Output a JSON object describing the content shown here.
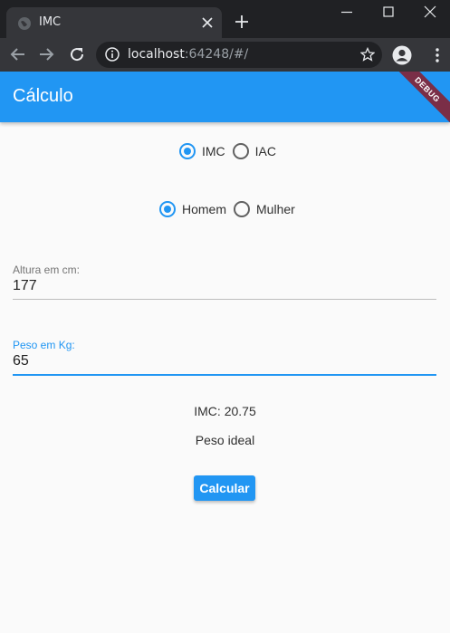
{
  "browser": {
    "tab_title": "IMC",
    "url_host": "localhost",
    "url_rest": ":64248/#/"
  },
  "app": {
    "title": "Cálculo",
    "debug_banner": "DEBUG",
    "calc_type": {
      "options": [
        "IMC",
        "IAC"
      ],
      "selected": "IMC"
    },
    "sex": {
      "options": [
        "Homem",
        "Mulher"
      ],
      "selected": "Homem"
    },
    "height_field": {
      "label": "Altura em cm:",
      "value": "177"
    },
    "weight_field": {
      "label": "Peso em Kg:",
      "value": "65"
    },
    "result_text": "IMC: 20.75",
    "classification": "Peso ideal",
    "calculate_button": "Calcular"
  },
  "colors": {
    "primary": "#2196f3",
    "chrome_dark": "#202124",
    "chrome_tab": "#35363a",
    "background": "#fafafa"
  }
}
